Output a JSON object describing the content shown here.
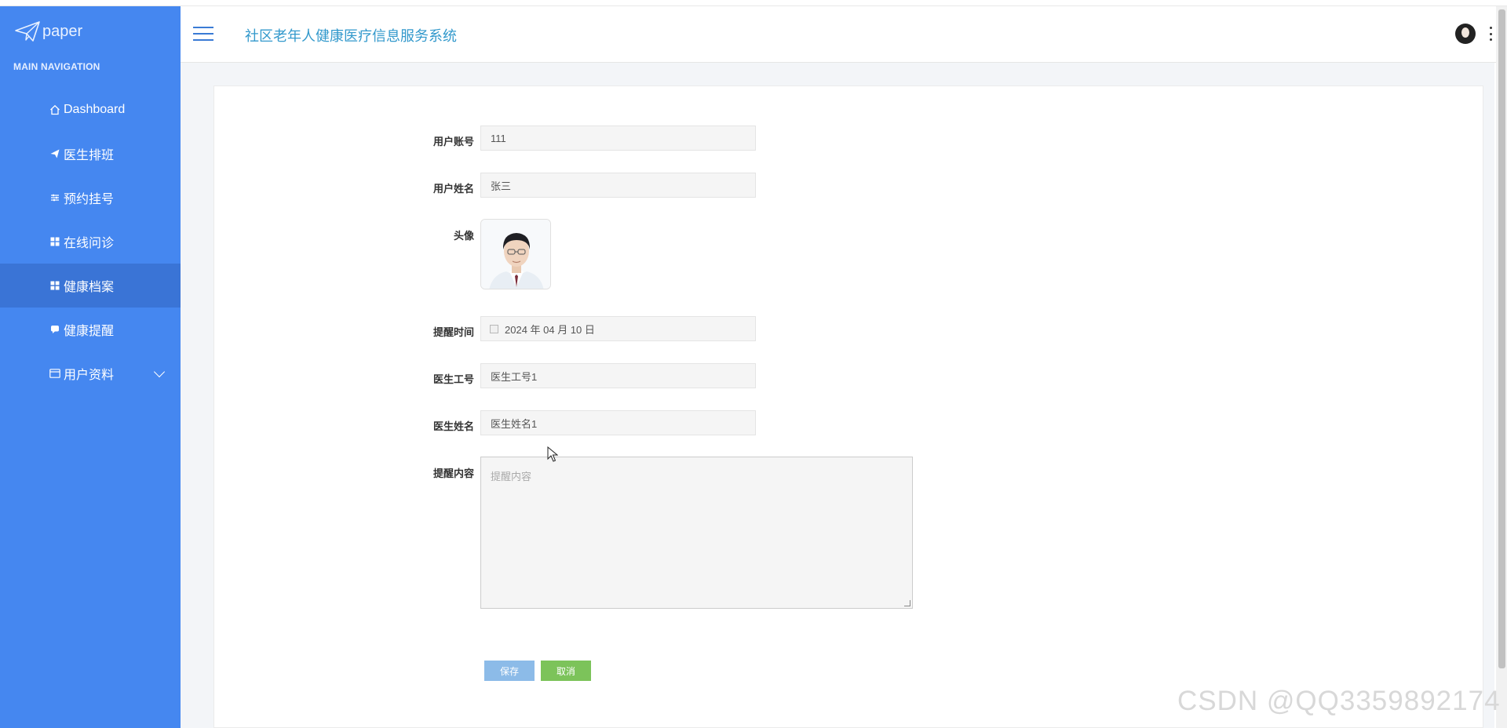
{
  "app": {
    "brand": "paper",
    "system_title": "社区老年人健康医疗信息服务系统"
  },
  "sidebar": {
    "caption": "MAIN NAVIGATION",
    "items": [
      {
        "label": "Dashboard",
        "icon": "home-icon"
      },
      {
        "label": "医生排班",
        "icon": "send-icon"
      },
      {
        "label": "预约挂号",
        "icon": "sliders-icon"
      },
      {
        "label": "在线问诊",
        "icon": "grid-icon"
      },
      {
        "label": "健康档案",
        "icon": "grid-icon",
        "active": true
      },
      {
        "label": "健康提醒",
        "icon": "chat-icon"
      },
      {
        "label": "用户资料",
        "icon": "card-icon",
        "has_submenu": true
      }
    ]
  },
  "form": {
    "account": {
      "label": "用户账号",
      "value": "111"
    },
    "name": {
      "label": "用户姓名",
      "value": "张三"
    },
    "avatar": {
      "label": "头像"
    },
    "remind_time": {
      "label": "提醒时间",
      "value": "2024 年 04 月 10 日"
    },
    "doctor_id": {
      "label": "医生工号",
      "value": "医生工号1"
    },
    "doctor_name": {
      "label": "医生姓名",
      "value": "医生姓名1"
    },
    "content": {
      "label": "提醒内容",
      "placeholder": "提醒内容"
    },
    "save_label": "保存",
    "cancel_label": "取消"
  },
  "watermark": "CSDN @QQ3359892174",
  "colors": {
    "sidebar": "#4587f0",
    "sidebar_active": "#3a74d6",
    "title": "#3399cc",
    "save_button": "#8cbbe8",
    "cancel_button": "#7cc35a"
  }
}
